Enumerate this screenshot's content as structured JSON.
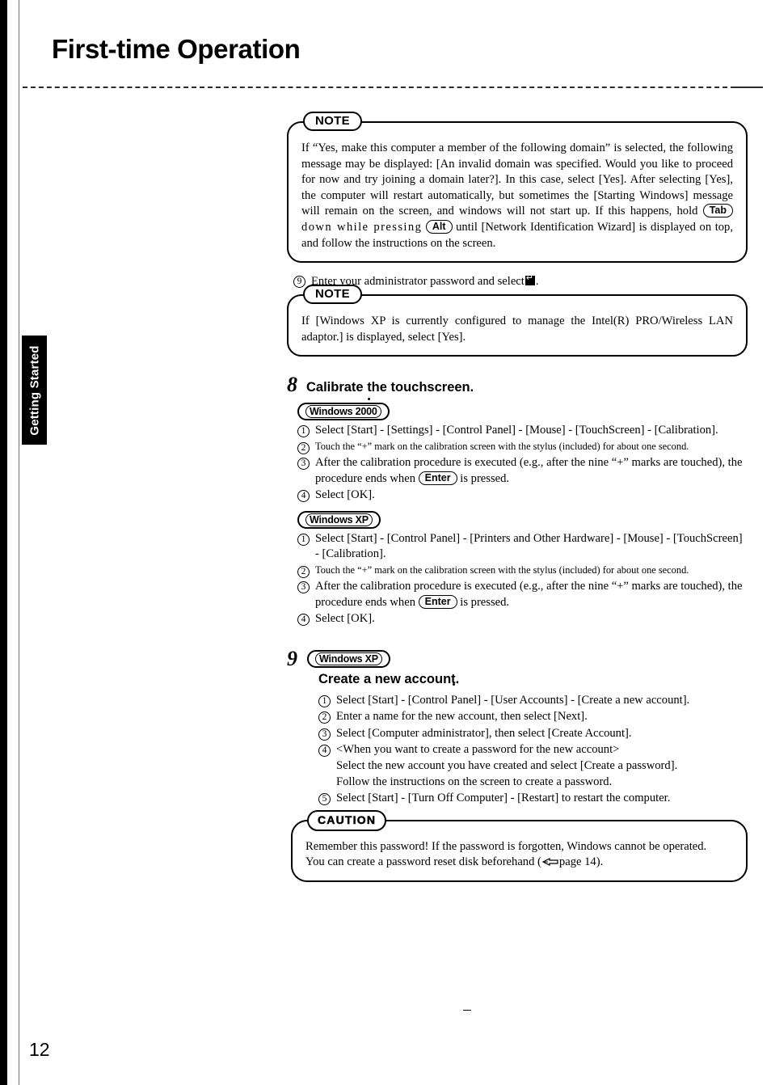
{
  "page": {
    "title": "First-time Operation",
    "number": "12",
    "side_tab": "Getting Started"
  },
  "note1": {
    "label": "NOTE",
    "text_parts": {
      "p1": "If “Yes, make this computer a member of the following domain” is selected, the following message may be displayed: [An invalid domain was specified. Would you like to proceed for now and try joining a domain later?]. In this case, select [Yes]. After selecting [Yes], the computer will restart automatically, but sometimes the [Starting Windows] message will remain on the screen, and windows will not start up.  If this happens, hold",
      "key1": "Tab",
      "p2": "down  while  pressing",
      "key2": "Alt",
      "p3": "until [Network Identification Wizard] is displayed on top, and follow the instructions on the screen."
    }
  },
  "step_enter_password": {
    "marker": "9",
    "text": "Enter your administrator password and select"
  },
  "note2": {
    "label": "NOTE",
    "text": "If [Windows XP is currently configured to manage the Intel(R) PRO/Wireless LAN adaptor.] is displayed, select [Yes]."
  },
  "step8": {
    "number": "8",
    "title": "Calibrate the touchscreen.",
    "os_win2000": "Windows 2000",
    "os_winxp": "Windows XP",
    "win2000_items": [
      {
        "marker": "1",
        "text": "Select [Start] - [Settings] - [Control Panel] - [Mouse] - [TouchScreen] - [Calibration].",
        "small": false
      },
      {
        "marker": "2",
        "text": "Touch the “+” mark on the calibration screen  with the stylus (included) for about one second.",
        "small": true
      },
      {
        "marker": "3",
        "text_before": "After the calibration procedure is executed (e.g., after the nine “+” marks are touched), the procedure ends when",
        "key": "Enter",
        "text_after": "is pressed.",
        "small": false
      },
      {
        "marker": "4",
        "text": "Select [OK].",
        "small": false
      }
    ],
    "winxp_items": [
      {
        "marker": "1",
        "text": "Select [Start] - [Control Panel] - [Printers and Other Hardware] - [Mouse] - [TouchScreen] - [Calibration].",
        "small": false
      },
      {
        "marker": "2",
        "text": "Touch the “+” mark on the calibration screen  with the stylus (included) for about one second.",
        "small": true
      },
      {
        "marker": "3",
        "text_before": "After the calibration procedure is executed (e.g., after the nine “+” marks are touched), the procedure ends when",
        "key": "Enter",
        "text_after": "is pressed.",
        "small": false
      },
      {
        "marker": "4",
        "text": "Select [OK].",
        "small": false
      }
    ]
  },
  "step9": {
    "number": "9",
    "os_winxp": "Windows XP",
    "title": "Create a new account.",
    "items": [
      {
        "marker": "1",
        "text": "Select [Start] - [Control Panel] - [User Accounts] - [Create a new account]."
      },
      {
        "marker": "2",
        "text": "Enter a name for the new account, then select [Next]."
      },
      {
        "marker": "3",
        "text": "Select [Computer administrator], then select [Create Account]."
      },
      {
        "marker": "4",
        "text": "<When you want to create a password for the new account>",
        "line2": "Select the new account you have created and select [Create a password].",
        "line3": "Follow the instructions on the screen to create a password."
      },
      {
        "marker": "5",
        "text": "Select [Start] - [Turn Off Computer] - [Restart] to restart the computer."
      }
    ]
  },
  "caution": {
    "label": "CAUTION",
    "line1": "Remember this password!  If the password is forgotten, Windows cannot be operated.",
    "line2_before": "You can create a password reset disk beforehand (",
    "line2_page": "page 14).",
    "icon": "pointing-hand-icon"
  }
}
